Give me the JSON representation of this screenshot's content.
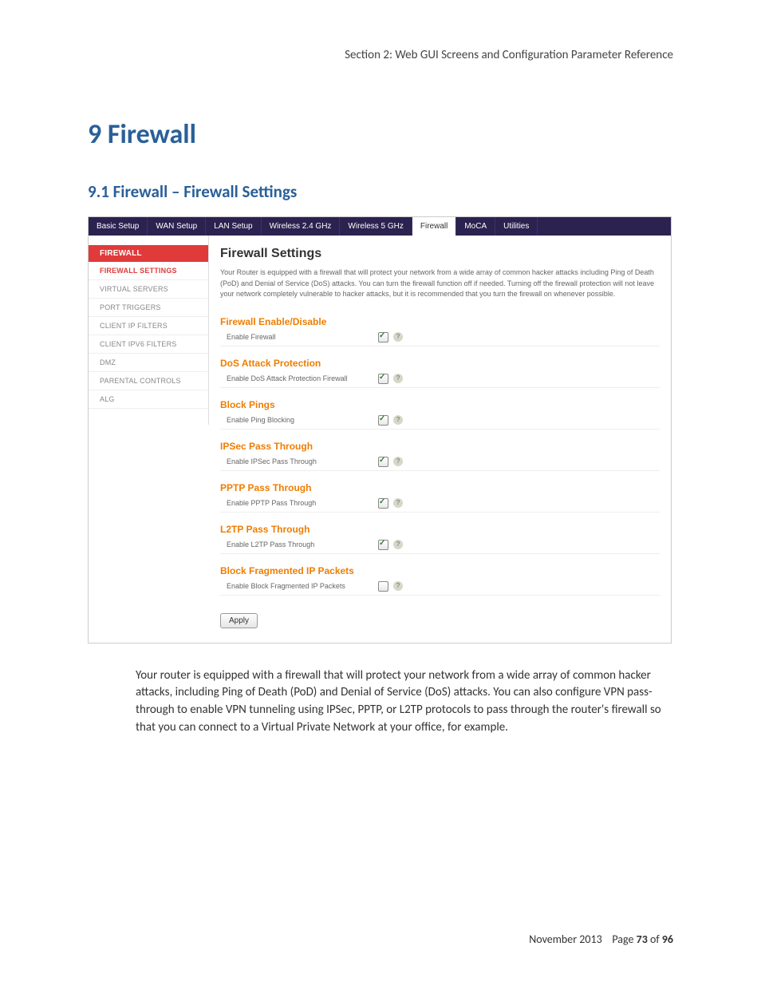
{
  "header": {
    "section_label": "Section 2:  Web GUI Screens and Configuration Parameter Reference"
  },
  "chapter": {
    "number_title": "9  Firewall"
  },
  "subsection": {
    "number_title": "9.1  Firewall – Firewall Settings"
  },
  "router": {
    "tabs": {
      "basic_setup": "Basic Setup",
      "wan_setup": "WAN Setup",
      "lan_setup": "LAN Setup",
      "wireless24": "Wireless 2.4 GHz",
      "wireless5": "Wireless 5 GHz",
      "firewall": "Firewall",
      "moca": "MoCA",
      "utilities": "Utilities"
    },
    "side": {
      "group": "FIREWALL",
      "firewall_settings": "FIREWALL SETTINGS",
      "virtual_servers": "VIRTUAL SERVERS",
      "port_triggers": "PORT TRIGGERS",
      "client_ip_filters": "CLIENT IP FILTERS",
      "client_ipv6_filters": "CLIENT IPV6 FILTERS",
      "dmz": "DMZ",
      "parental_controls": "PARENTAL CONTROLS",
      "alg": "ALG"
    },
    "title": "Firewall Settings",
    "description": "Your Router is equipped with a firewall that will protect your network from a wide array of common hacker attacks including Ping of Death (PoD) and Denial of Service (DoS) attacks. You can turn the firewall function off if needed. Turning off the firewall protection will not leave your network completely vulnerable to hacker attacks, but it is recommended that you turn the firewall on whenever possible.",
    "sections": {
      "enable": {
        "title": "Firewall Enable/Disable",
        "label": "Enable Firewall",
        "checked": true
      },
      "dos": {
        "title": "DoS Attack Protection",
        "label": "Enable DoS Attack Protection Firewall",
        "checked": true
      },
      "pings": {
        "title": "Block Pings",
        "label": "Enable Ping Blocking",
        "checked": true
      },
      "ipsec": {
        "title": "IPSec Pass Through",
        "label": "Enable IPSec Pass Through",
        "checked": true
      },
      "pptp": {
        "title": "PPTP Pass Through",
        "label": "Enable PPTP Pass Through",
        "checked": true
      },
      "l2tp": {
        "title": "L2TP Pass Through",
        "label": "Enable L2TP Pass Through",
        "checked": true
      },
      "frag": {
        "title": "Block Fragmented IP Packets",
        "label": "Enable Block Fragmented IP Packets",
        "checked": false
      }
    },
    "apply": "Apply"
  },
  "paragraph": "Your router is equipped with a firewall that will protect your network from a wide array of common hacker attacks, including Ping of Death (PoD) and Denial of Service (DoS) attacks.  You can also configure VPN pass-through to enable VPN tunneling using IPSec, PPTP, or L2TP protocols to pass through the router's firewall so that you can connect to a Virtual Private Network at your office, for example.",
  "footer": {
    "date": "November 2013",
    "page_label": "Page ",
    "page_current": "73",
    "page_of": " of ",
    "page_total": "96"
  }
}
